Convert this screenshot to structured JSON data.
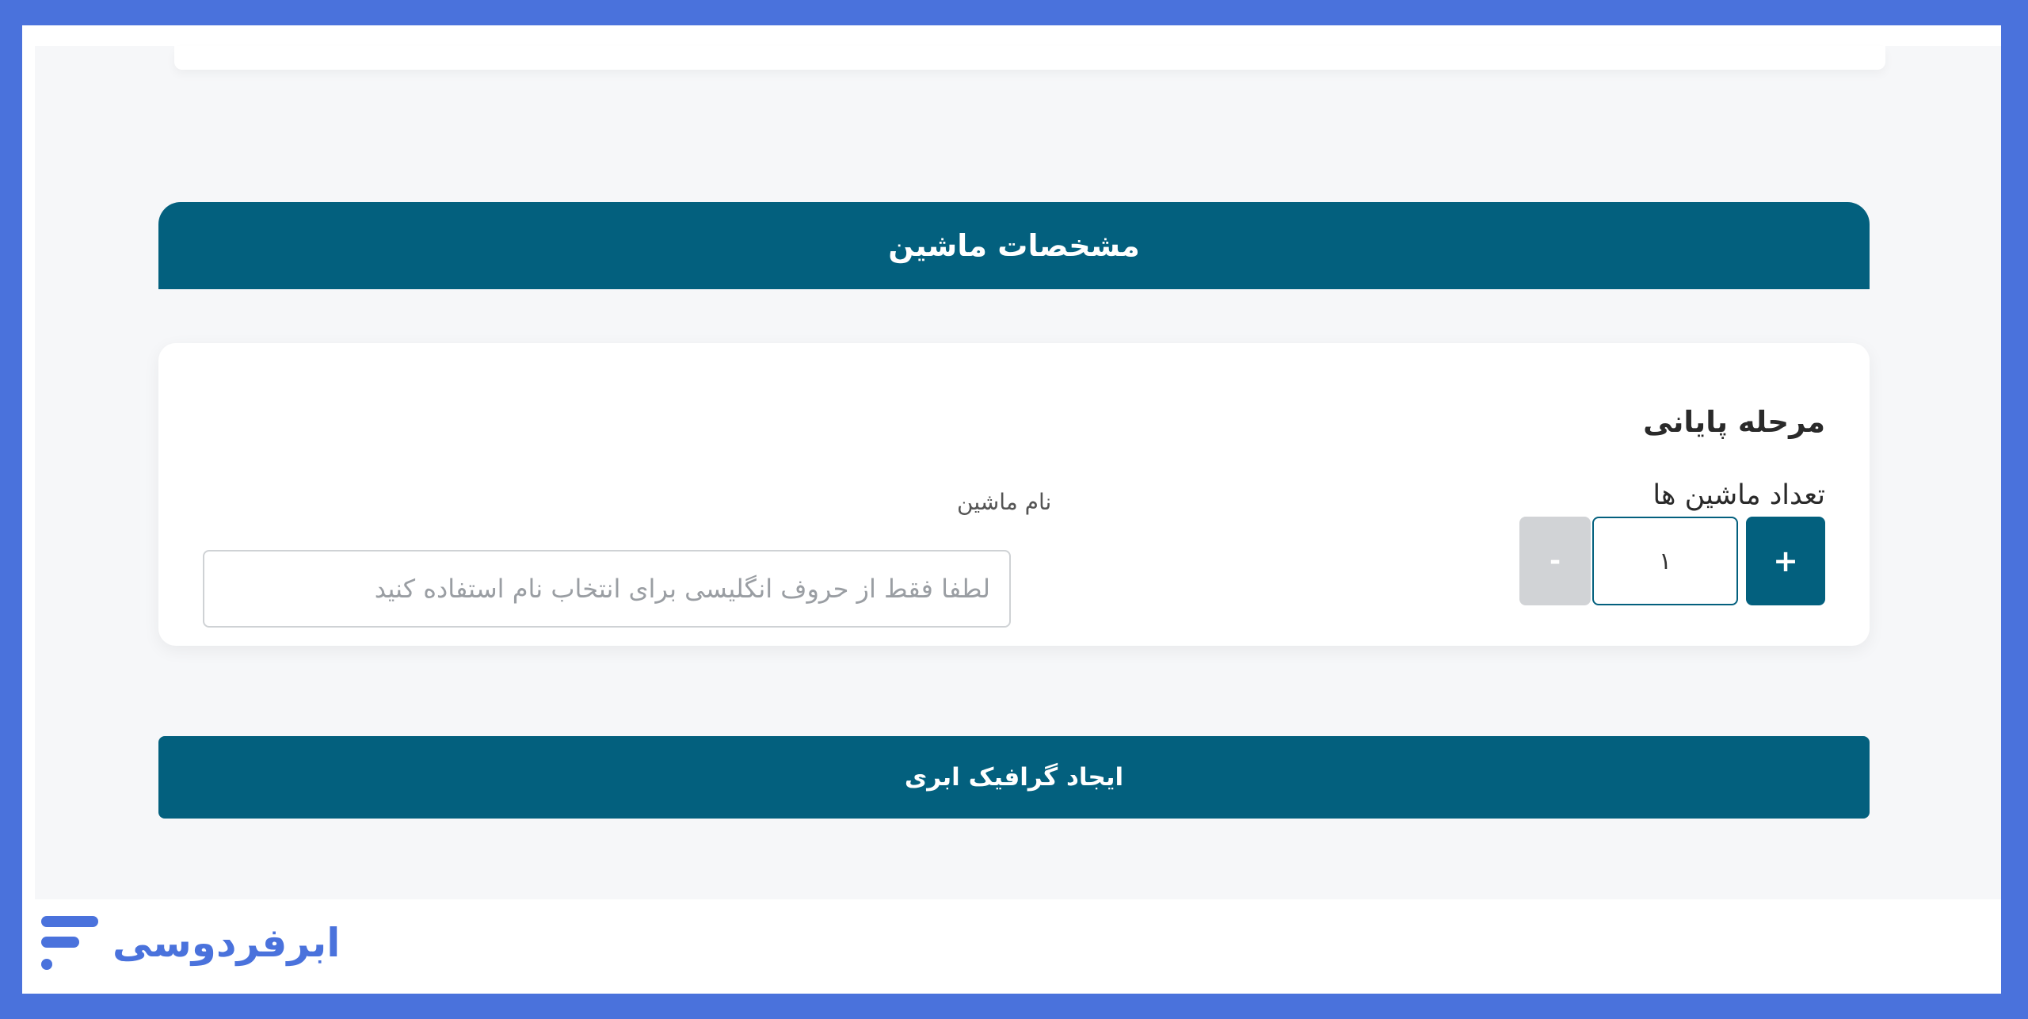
{
  "section": {
    "title": "مشخصات ماشین"
  },
  "card": {
    "title": "مرحله پایانی",
    "count_label": "تعداد ماشین ها",
    "count_value": "۱",
    "plus_label": "+",
    "minus_label": "-",
    "name_label": "نام ماشین",
    "name_placeholder": "لطفا فقط از حروف انگلیسی برای انتخاب نام استفاده کنید"
  },
  "actions": {
    "create_label": "ایجاد گرافیک ابری"
  },
  "brand": {
    "name": "ابرفردوسی",
    "color": "#4a72dc"
  },
  "colors": {
    "primary": "#03607e",
    "disabled": "#d1d3d6",
    "background": "#f6f7f9"
  }
}
